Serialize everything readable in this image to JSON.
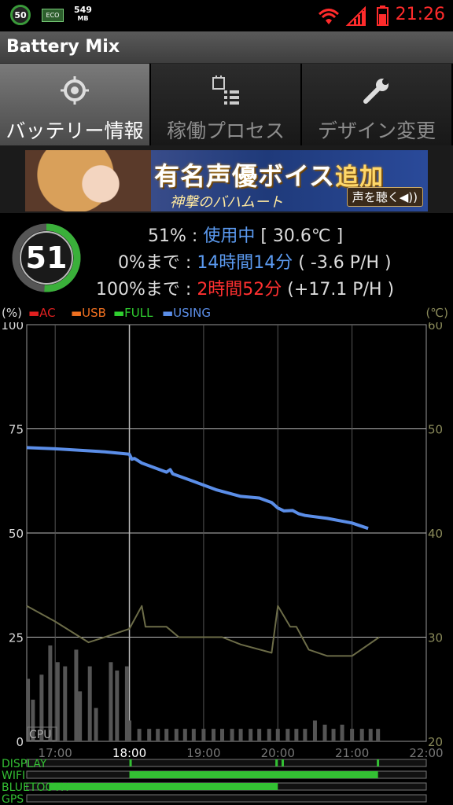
{
  "statusbar": {
    "battery_circle": "50",
    "eco": "ECO",
    "memory_value": "549",
    "memory_unit": "MB",
    "time": "21:26",
    "icons": [
      "wifi-icon",
      "signal-icon",
      "battery-low-icon"
    ]
  },
  "app": {
    "title": "Battery Mix"
  },
  "tabs": [
    {
      "label": "バッテリー情報",
      "icon": "target-icon",
      "active": true
    },
    {
      "label": "稼働プロセス",
      "icon": "process-list-icon",
      "active": false
    },
    {
      "label": "デザイン変更",
      "icon": "wrench-icon",
      "active": false
    }
  ],
  "banner": {
    "headline": "有名声優ボイス",
    "headline_suffix": "追加",
    "subline": "神撃のバハムート",
    "button": "声を聴く◀))"
  },
  "battery": {
    "level": "51",
    "row1": {
      "percent": "51%",
      "sep": " : ",
      "status": "使用中",
      "temp": " [ 30.6℃ ]"
    },
    "row2": {
      "label": "0%まで",
      "sep": " : ",
      "time": "14時間14分",
      "rate": " ( -3.6 P/H )"
    },
    "row3": {
      "label": "100%まで",
      "sep": " : ",
      "time": "2時間52分",
      "rate": " (+17.1 P/H )"
    }
  },
  "legend": {
    "left_unit": "(%)",
    "right_unit": "(℃)",
    "items": [
      {
        "label": "AC",
        "color": "#e02020"
      },
      {
        "label": "USB",
        "color": "#f07020"
      },
      {
        "label": "FULL",
        "color": "#30d030"
      },
      {
        "label": "USING",
        "color": "#5b8ee8"
      }
    ]
  },
  "chart_data": {
    "type": "line",
    "x_ticks": [
      "17:00",
      "18:00",
      "19:00",
      "20:00",
      "21:00",
      "22:00"
    ],
    "y_left_ticks": [
      0,
      25,
      50,
      75,
      100
    ],
    "y_right_ticks": [
      20,
      30,
      40,
      50,
      60
    ],
    "cpu_label": "CPU",
    "series": [
      {
        "name": "USING",
        "color": "#5b8ee8",
        "axis": "left",
        "x": [
          "16:37",
          "17:00",
          "17:40",
          "18:00",
          "18:02",
          "18:04",
          "18:10",
          "18:30",
          "18:33",
          "18:35",
          "18:50",
          "19:10",
          "19:30",
          "19:45",
          "19:55",
          "20:00",
          "20:05",
          "20:12",
          "20:17",
          "20:22",
          "20:40",
          "21:00",
          "21:13"
        ],
        "values": [
          70.5,
          70.2,
          69.5,
          68.9,
          67.7,
          67.9,
          66.8,
          64.6,
          65.2,
          64.2,
          62.6,
          60.4,
          58.8,
          58.4,
          57.3,
          56.0,
          55.3,
          55.4,
          54.6,
          54.2,
          53.5,
          52.4,
          51.1
        ]
      },
      {
        "name": "temperature",
        "color": "#6c6c48",
        "axis": "right",
        "x": [
          "16:37",
          "17:00",
          "17:27",
          "17:40",
          "18:00",
          "18:10",
          "18:13",
          "18:30",
          "18:40",
          "19:00",
          "19:15",
          "19:30",
          "19:55",
          "20:00",
          "20:10",
          "20:15",
          "20:25",
          "20:40",
          "21:00",
          "21:22"
        ],
        "values": [
          33.0,
          31.5,
          29.5,
          30.0,
          30.8,
          33.0,
          31.0,
          31.0,
          30.0,
          30.0,
          30.0,
          29.3,
          28.5,
          33.0,
          31.0,
          31.0,
          28.8,
          28.2,
          28.2,
          30.0
        ]
      }
    ],
    "cpu_bars": {
      "color": "#555555",
      "x": [
        "16:38",
        "16:42",
        "16:49",
        "16:56",
        "17:02",
        "17:08",
        "17:17",
        "17:20",
        "17:28",
        "17:33",
        "17:45",
        "17:50",
        "17:58",
        "18:00",
        "18:08",
        "18:16",
        "18:23",
        "18:30",
        "18:38",
        "18:45",
        "18:52",
        "19:00",
        "19:08",
        "19:15",
        "19:23",
        "19:30",
        "19:38",
        "19:45",
        "19:53",
        "20:00",
        "20:08",
        "20:15",
        "20:22",
        "20:30",
        "20:38",
        "20:45",
        "20:52",
        "21:00",
        "21:08",
        "21:15",
        "21:21"
      ],
      "values": [
        15,
        10,
        16,
        23,
        19,
        18,
        22,
        12,
        18,
        8,
        19,
        17,
        18,
        5,
        3,
        3,
        3,
        3,
        3,
        3,
        3,
        3,
        3,
        3,
        3,
        3,
        3,
        3,
        3,
        3,
        3,
        3,
        3,
        5,
        4,
        3,
        4,
        3,
        3,
        3,
        3
      ]
    },
    "timeline_tracks": [
      {
        "label": "DISPLAY",
        "segments": [
          [
            "18:00",
            "18:01"
          ],
          [
            "19:58",
            "20:00"
          ],
          [
            "20:03",
            "20:04"
          ],
          [
            "21:20",
            "21:21"
          ]
        ]
      },
      {
        "label": "WIFI",
        "segments": [
          [
            "18:00",
            "21:21"
          ]
        ]
      },
      {
        "label": "BLUETOOTH",
        "segments": [
          [
            "16:55",
            "20:00"
          ]
        ]
      },
      {
        "label": "GPS",
        "segments": []
      }
    ]
  }
}
